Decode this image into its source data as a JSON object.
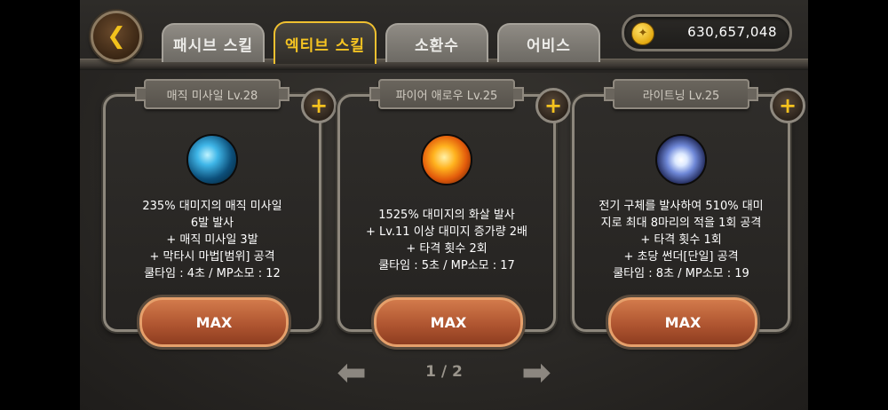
{
  "header": {
    "tabs": [
      {
        "label": "패시브 스킬",
        "active": false
      },
      {
        "label": "엑티브 스킬",
        "active": true
      },
      {
        "label": "소환수",
        "active": false
      },
      {
        "label": "어비스",
        "active": false
      }
    ],
    "gold": "630,657,048",
    "icons": {
      "back": "back-arrow-icon",
      "coin": "gold-coin-icon"
    }
  },
  "cards": [
    {
      "title": "매직 미사일 Lv.28",
      "icon": "magic-missile-skill-icon",
      "desc": [
        "235% 대미지의 매직 미사일",
        "6발 발사",
        "+ 매직 미사일 3발",
        "+ 막타시 마법[범위] 공격",
        "쿨타임 : 4초 / MP소모 : 12"
      ],
      "button": "MAX"
    },
    {
      "title": "파이어 애로우 Lv.25",
      "icon": "fire-arrow-skill-icon",
      "desc": [
        "1525% 대미지의 화살 발사",
        "+ Lv.11 이상 대미지 증가량 2배",
        "+ 타격 횟수 2회",
        "쿨타임 : 5초 / MP소모 : 17"
      ],
      "button": "MAX"
    },
    {
      "title": "라이트닝 Lv.25",
      "icon": "lightning-skill-icon",
      "desc": [
        "전기 구체를 발사하여 510% 대미",
        "지로 최대 8마리의 적을 1회 공격",
        "+ 타격 횟수 1회",
        "+ 초당 썬더[단일] 공격",
        "쿨타임 : 8초 / MP소모 : 19"
      ],
      "button": "MAX"
    }
  ],
  "pager": {
    "text": "1 / 2"
  },
  "colors": {
    "accent": "#f5c422",
    "button": "#b05631"
  }
}
